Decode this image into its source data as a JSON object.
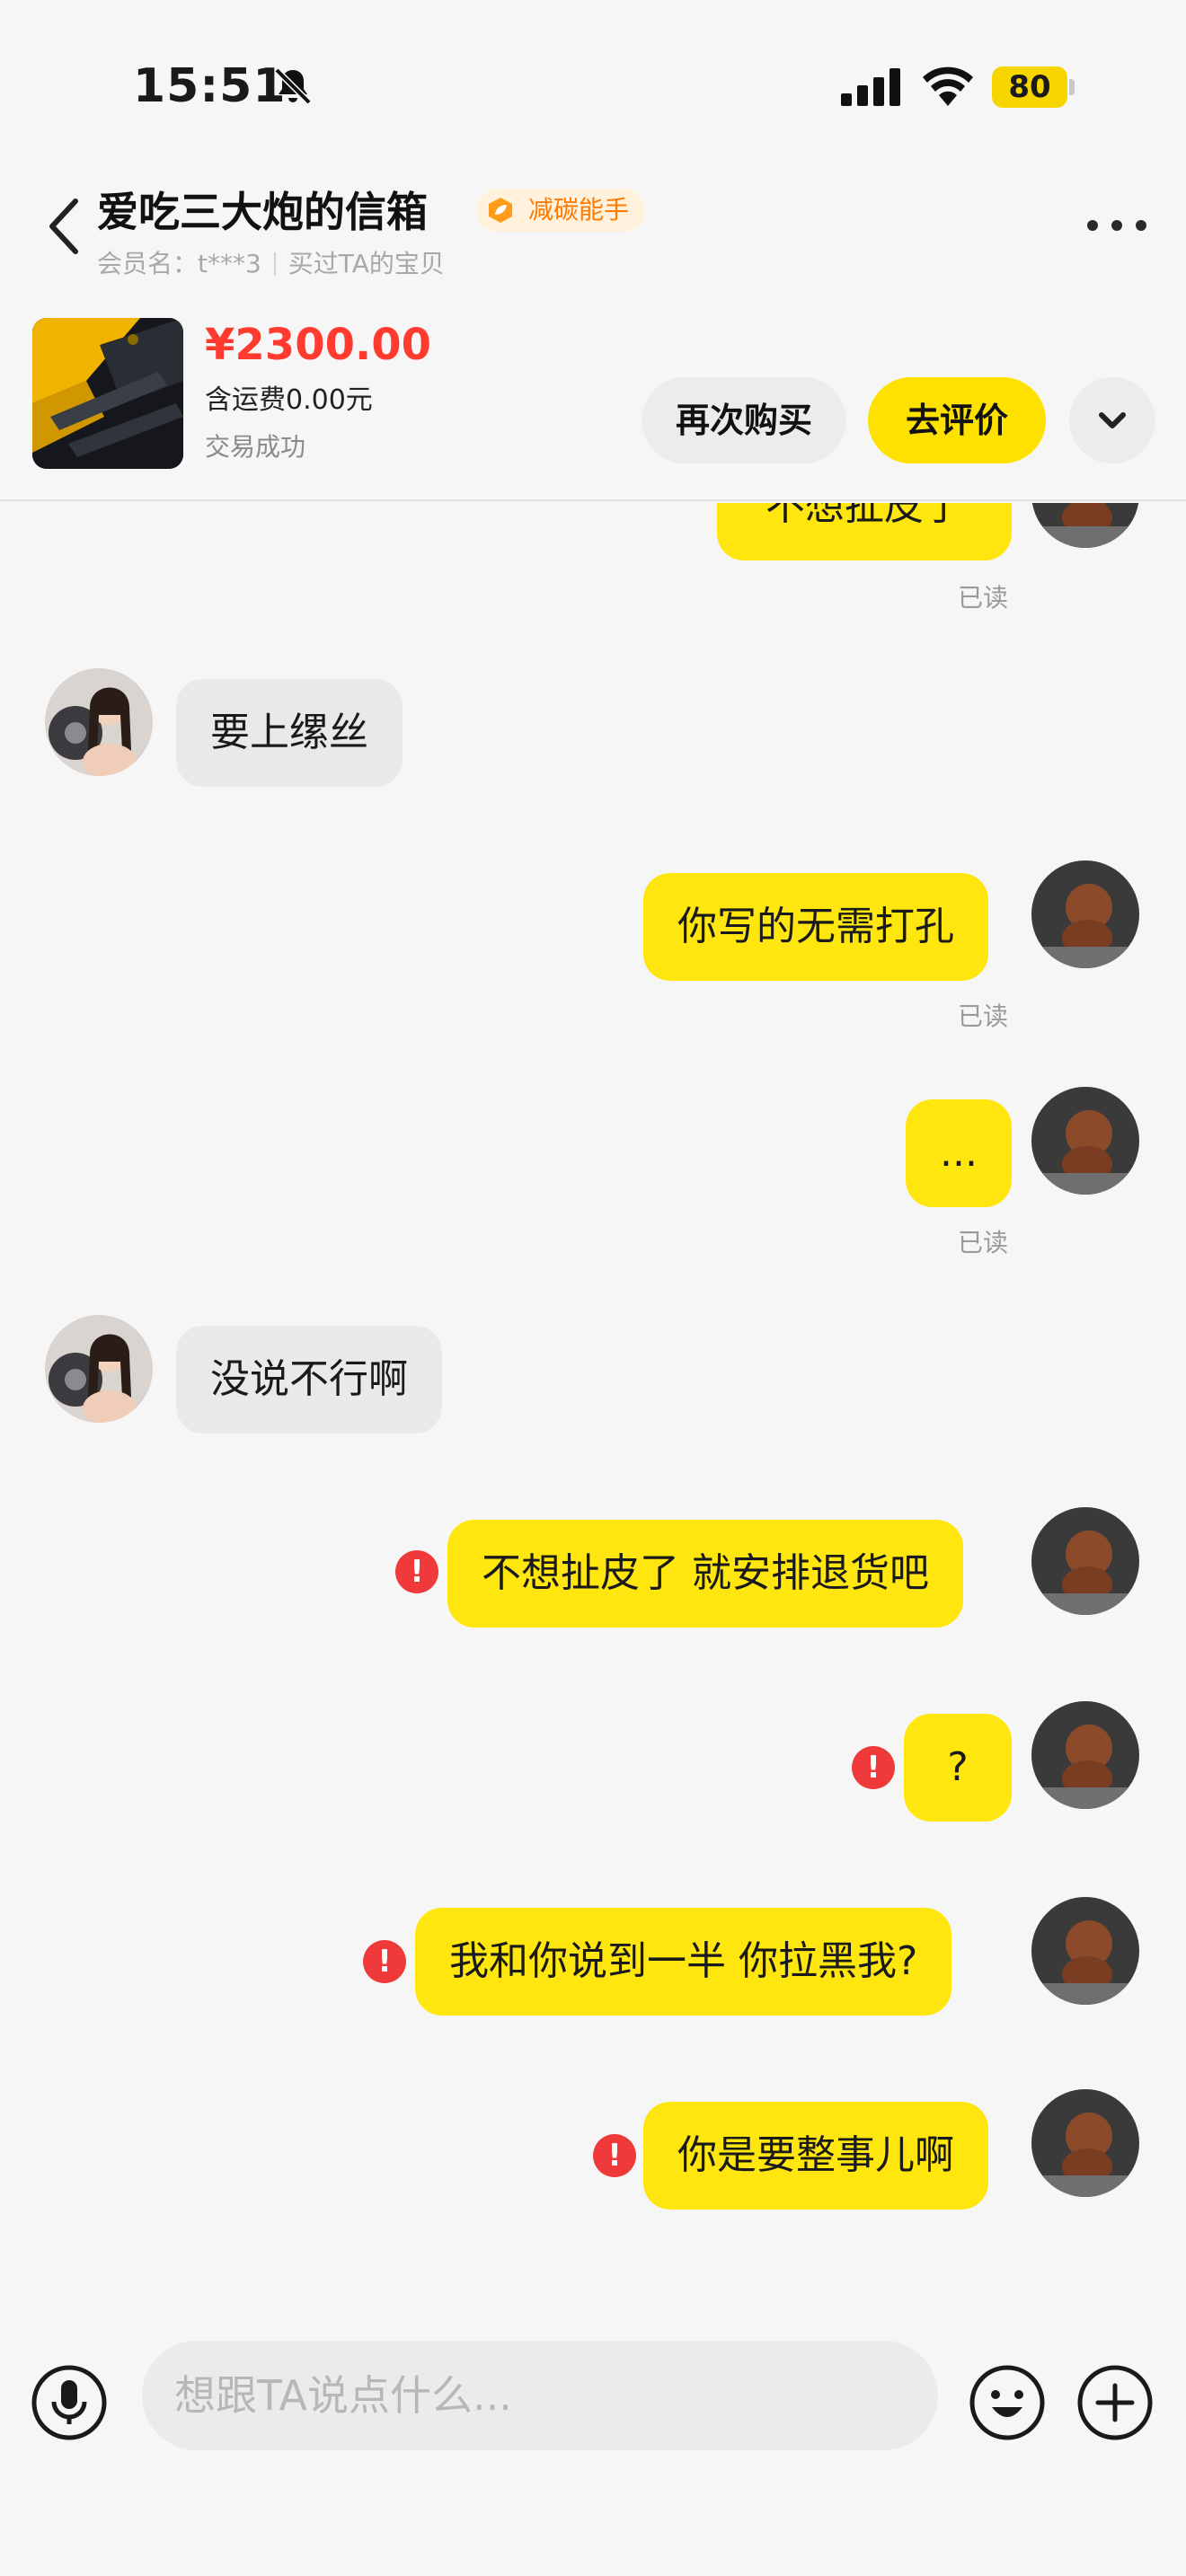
{
  "status_bar": {
    "time": "15:51",
    "battery": "80"
  },
  "header": {
    "title": "爱吃三大炮的信箱",
    "badge": "减碳能手",
    "member_label": "会员名：t***3",
    "bought_label": "买过TA的宝贝",
    "icons": [
      "back-chevron-icon",
      "more-dots-icon",
      "bell-muted-icon"
    ]
  },
  "order": {
    "price": "¥2300.00",
    "shipping": "含运费0.00元",
    "status": "交易成功",
    "rebuy_label": "再次购买",
    "review_label": "去评价"
  },
  "messages": [
    {
      "from": "me",
      "text": "不想扯皮了",
      "read": "已读"
    },
    {
      "from": "them",
      "text": "要上缧丝"
    },
    {
      "from": "me",
      "text": "你写的无需打孔",
      "read": "已读"
    },
    {
      "from": "me",
      "text": "...",
      "read": "已读"
    },
    {
      "from": "them",
      "text": "没说不行啊"
    },
    {
      "from": "me",
      "text": "不想扯皮了 就安排退货吧",
      "error": "!"
    },
    {
      "from": "me",
      "text": "?",
      "error": "!"
    },
    {
      "from": "me",
      "text": "我和你说到一半 你拉黑我?",
      "error": "!"
    },
    {
      "from": "me",
      "text": "你是要整事儿啊",
      "error": "!"
    }
  ],
  "input": {
    "placeholder": "想跟TA说点什么..."
  },
  "colors": {
    "bubble_me": "#ffe60f",
    "bubble_them": "#e9e9e9",
    "price": "#ff3b30",
    "error": "#f0393a",
    "accent": "#ffe100"
  }
}
